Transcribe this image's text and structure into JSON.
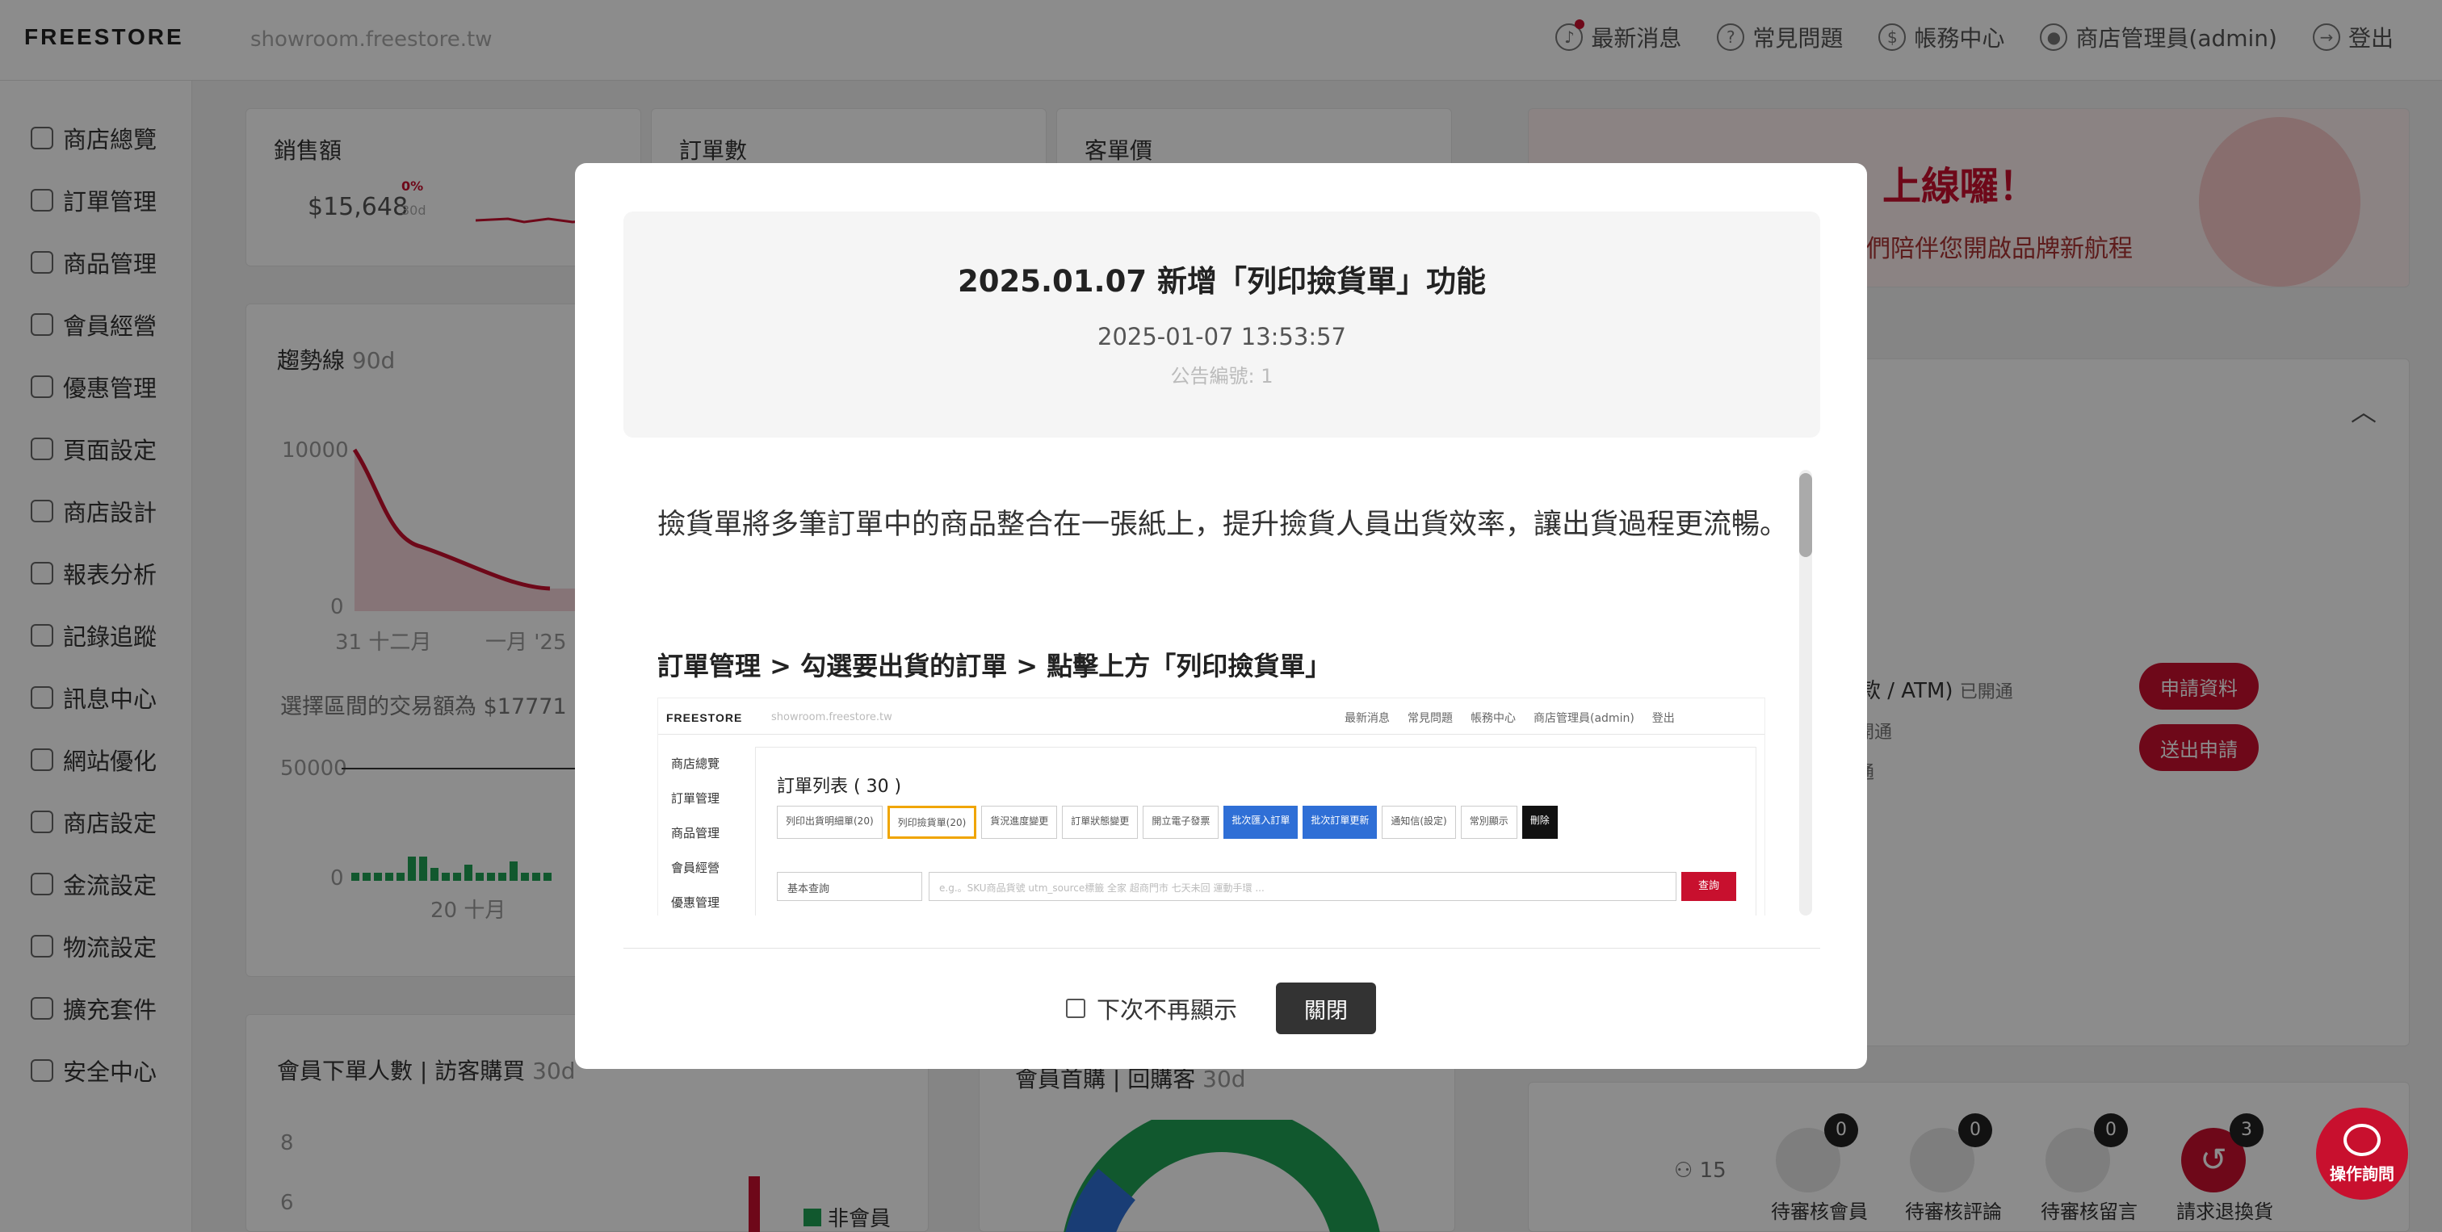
{
  "topbar": {
    "logo": "FREESTORE",
    "url": "showroom.freestore.tw",
    "nav": [
      "最新消息",
      "常見問題",
      "帳務中心",
      "商店管理員(admin)",
      "登出"
    ]
  },
  "sidebar": {
    "items": [
      "商店總覽",
      "訂單管理",
      "商品管理",
      "會員經營",
      "優惠管理",
      "頁面設定",
      "商店設計",
      "報表分析",
      "記錄追蹤",
      "訊息中心",
      "網站優化",
      "商店設定",
      "金流設定",
      "物流設定",
      "擴充套件",
      "安全中心"
    ]
  },
  "cards": {
    "sales": {
      "title": "銷售額",
      "value": "$15,648",
      "pct": "0%",
      "period": "30d"
    },
    "orders": {
      "title": "訂單數"
    },
    "aov": {
      "title": "客單價"
    },
    "trend": {
      "title": "趨勢線",
      "period": "90d",
      "y_max": "10000",
      "y_min": "0",
      "x1": "31 十二月",
      "x2": "一月 '25",
      "range_text": "選擇區間的交易額為 $17771",
      "y2_max": "50000",
      "y2_min": "0",
      "x3": "20 十月"
    },
    "members": {
      "title": "會員下單人數 | 訪客購買",
      "period": "30d",
      "y8": "8",
      "y6": "6",
      "legend": "非會員"
    },
    "banner": {
      "headline": "上線囉！",
      "sub": "們陪伴您開啟品牌新航程"
    },
    "payments": {
      "r1": "付款 / ATM)",
      "r1s": "已開通",
      "r2": "已開通",
      "r3": "開通",
      "r4": "通",
      "btn1": "申請資料",
      "btn2": "送出申請"
    },
    "pending": {
      "count": "15",
      "items": [
        {
          "label": "待審核會員",
          "badge": "0"
        },
        {
          "label": "待審核評論",
          "badge": "0"
        },
        {
          "label": "待審核留言",
          "badge": "0"
        },
        {
          "label": "請求退換貨",
          "badge": "3"
        }
      ]
    },
    "donut": {
      "title": "會員首購 | 回購客",
      "period": "30d"
    }
  },
  "modal": {
    "title": "2025.01.07 新增「列印撿貨單」功能",
    "datetime": "2025-01-07 13:53:57",
    "number": "公告編號: 1",
    "body": "撿貨單將多筆訂單中的商品整合在一張紙上，提升撿貨人員出貨效率，讓出貨過程更流暢。",
    "path": "訂單管理 > 勾選要出貨的訂單 > 點擊上方「列印撿貨單」",
    "dont_show": "下次不再顯示",
    "close": "關閉"
  },
  "embedded": {
    "logo": "FREESTORE",
    "url": "showroom.freestore.tw",
    "nav": [
      "最新消息",
      "常見問題",
      "帳務中心",
      "商店管理員(admin)",
      "登出"
    ],
    "side": [
      "商店總覽",
      "訂單管理",
      "商品管理",
      "會員經營",
      "優惠管理"
    ],
    "list_title": "訂單列表 ( 30 )",
    "buttons": [
      "列印出貨明細單(20)",
      "列印撿貨單(20)",
      "貨況進度變更",
      "訂單狀態變更",
      "開立電子發票",
      "批次匯入訂單",
      "批次訂單更新",
      "通知信(設定)",
      "常別顯示",
      "刪除"
    ],
    "query_select": "基本查詢",
    "query_placeholder": "e.g.。SKU商品貨號 utm_source標籤 全家 超商門市 七天未回 運動手環 ...",
    "query_btn": "查詢"
  },
  "chat": {
    "label": "操作詢問"
  },
  "colors": {
    "brand": "#c8102e",
    "primary_blue": "#2f6fd6",
    "highlight": "#f0a500"
  }
}
